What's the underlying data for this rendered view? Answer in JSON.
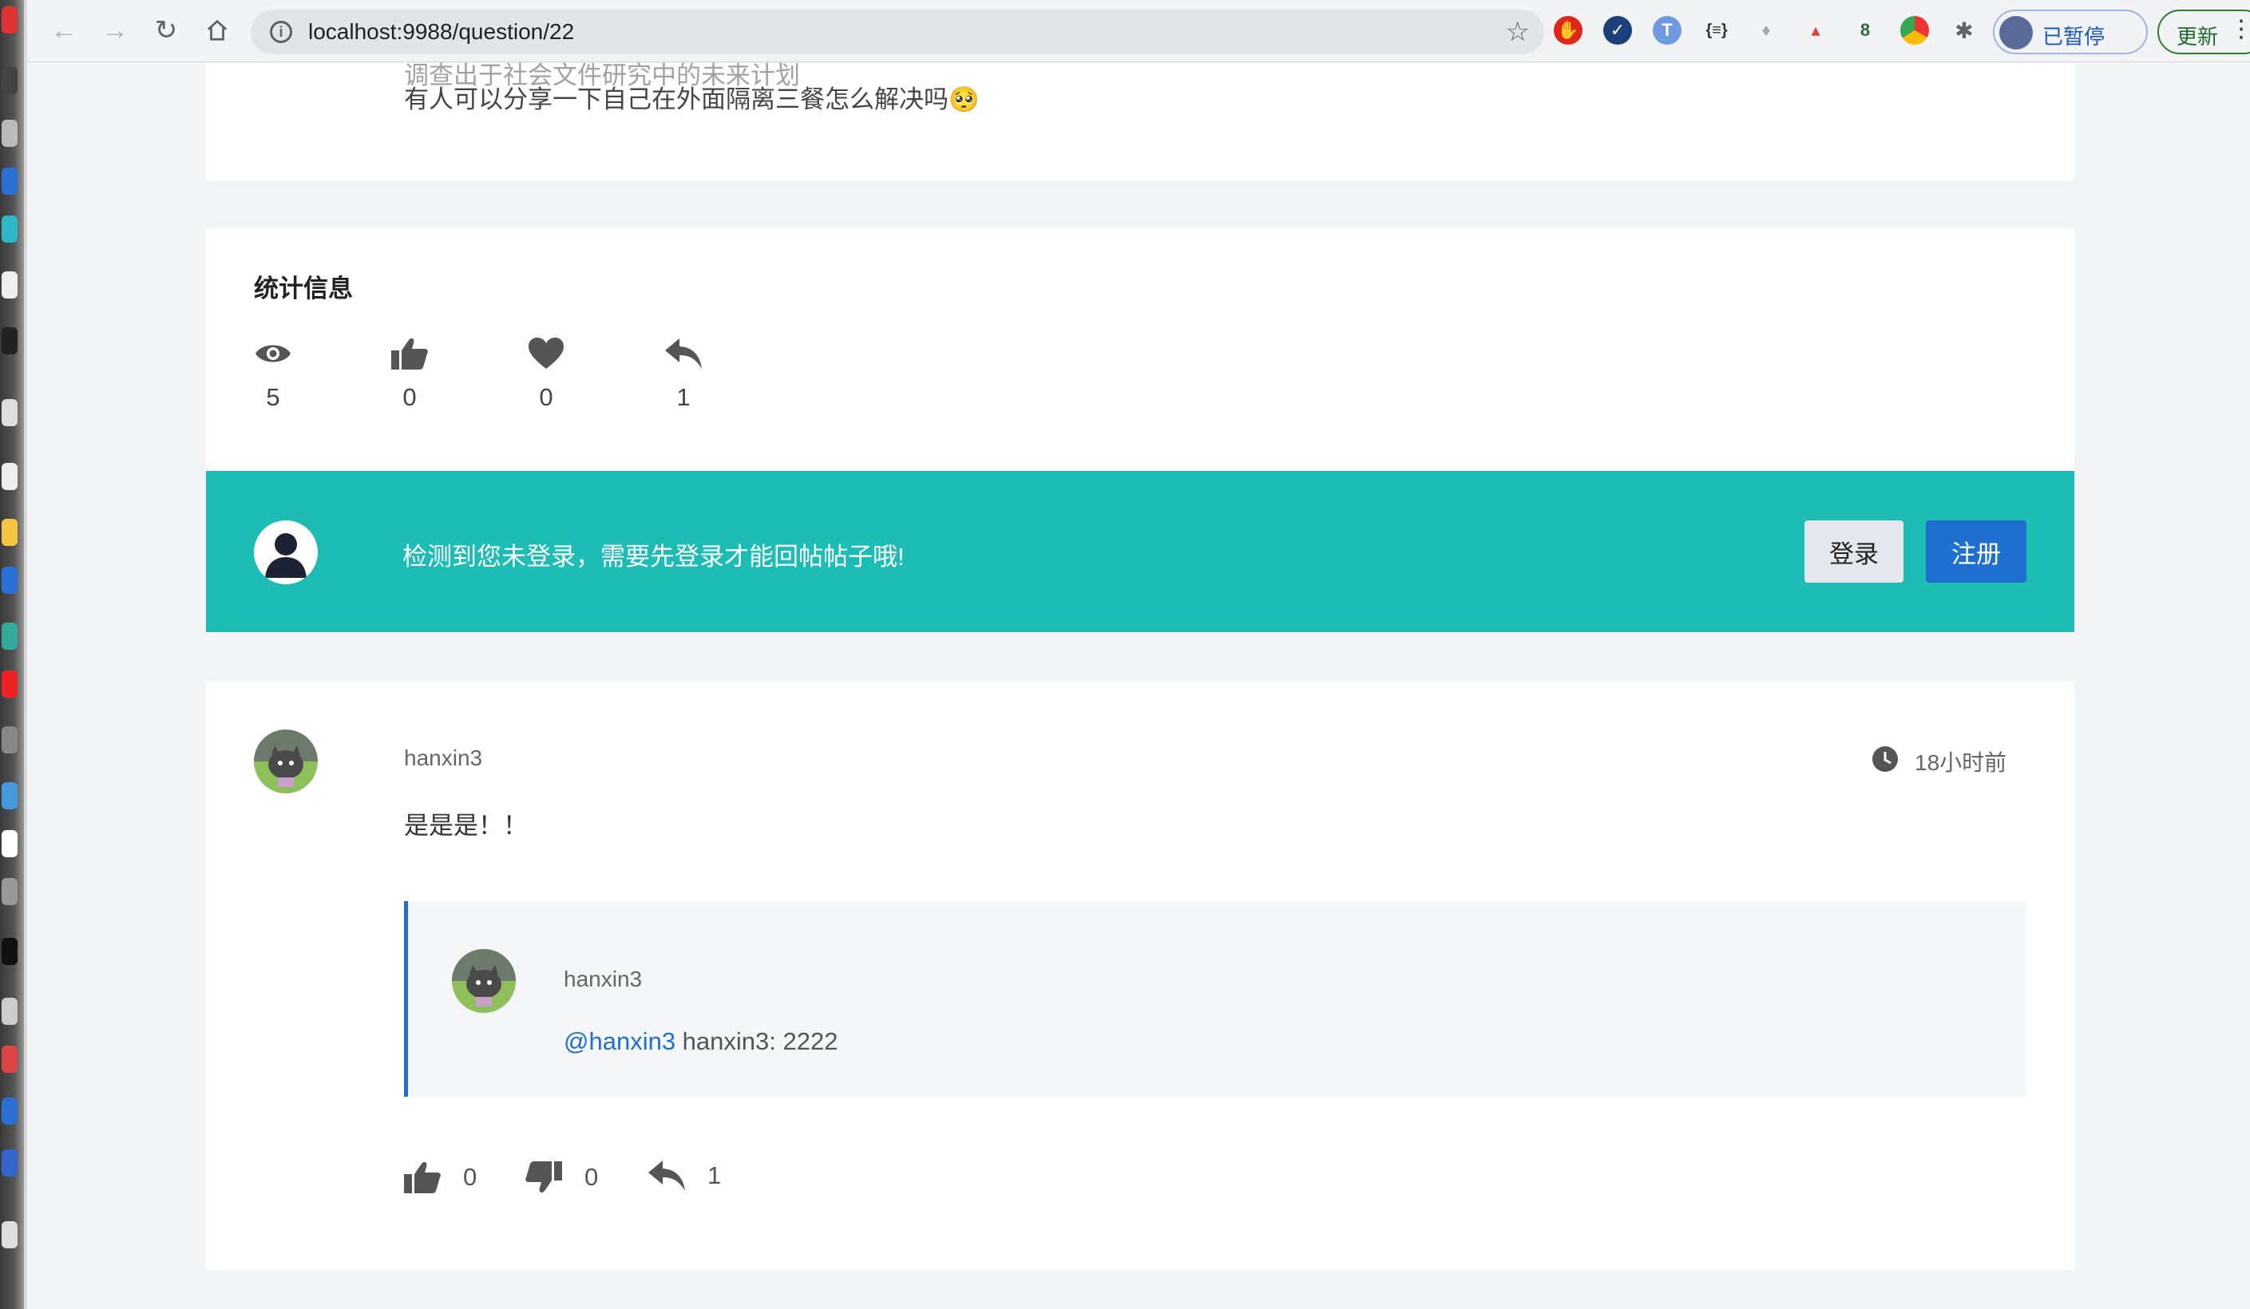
{
  "browser": {
    "url": "localhost:9988/question/22",
    "profile_label": "已暂停",
    "update_label": "更新"
  },
  "post": {
    "truncated_line": "调查出于社会文件研究中的未来计划",
    "last_line": "有人可以分享一下自己在外面隔离三餐怎么解决吗🥺"
  },
  "stats": {
    "title": "统计信息",
    "items": [
      {
        "icon": "eye-icon",
        "value": "5"
      },
      {
        "icon": "thumbs-up-icon",
        "value": "0"
      },
      {
        "icon": "heart-icon",
        "value": "0"
      },
      {
        "icon": "reply-icon",
        "value": "1"
      }
    ]
  },
  "login_banner": {
    "message": "检测到您未登录，需要先登录才能回帖帖子哦!",
    "login_label": "登录",
    "register_label": "注册",
    "color": "#1dbdb5"
  },
  "comment": {
    "username": "hanxin3",
    "time": "18小时前",
    "body": "是是是！！",
    "quote": {
      "username": "hanxin3",
      "mention": "@hanxin3",
      "text": " hanxin3: 2222"
    },
    "likes": "0",
    "dislikes": "0",
    "replies": "1"
  }
}
